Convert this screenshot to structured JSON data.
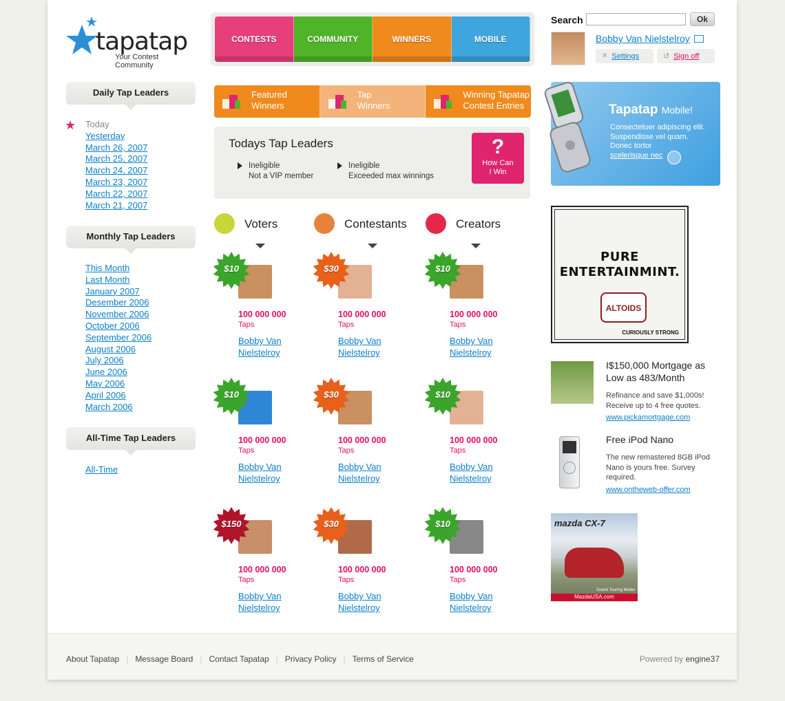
{
  "brand": {
    "name": "tapatap",
    "tagline": "Your Contest Community"
  },
  "nav": [
    {
      "label": "CONTESTS",
      "color": "#e63f7a"
    },
    {
      "label": "COMMUNITY",
      "color": "#4fb428"
    },
    {
      "label": "WINNERS",
      "color": "#f08a1c"
    },
    {
      "label": "MOBILE",
      "color": "#3ea5dd"
    }
  ],
  "search": {
    "label": "Search",
    "button": "Ok"
  },
  "user": {
    "name": "Bobby Van Nielstelroy",
    "settings": "Settings",
    "signoff": "Sign off"
  },
  "sidebar": {
    "daily": {
      "title": "Daily Tap Leaders",
      "today": "Today",
      "links": [
        "Yesterday",
        "March 26, 2007",
        "March 25, 2007",
        "March 24, 2007",
        "March 23, 2007",
        "March 22, 2007",
        "March 21, 2007"
      ]
    },
    "monthly": {
      "title": "Monthly Tap Leaders",
      "links": [
        "This Month",
        "Last Month",
        "January 2007",
        "Desember 2006",
        "November 2006",
        "October 2006",
        "September 2006",
        "August 2006",
        "July 2006",
        "June 2006",
        "May 2006",
        "April 2006",
        "March 2006"
      ]
    },
    "alltime": {
      "title": "All-Time Tap Leaders",
      "links": [
        "All-Time"
      ]
    }
  },
  "feature_tabs": [
    {
      "line1": "Featured",
      "line2": "Winners",
      "color": "#f08a1c"
    },
    {
      "line1": "Tap",
      "line2": "Winners",
      "color": "#f4b37a"
    },
    {
      "line1": "Winning Tapatap",
      "line2": "Contest Entries",
      "color": "#f08a1c"
    }
  ],
  "today": {
    "title": "Todays Tap Leaders",
    "items": [
      {
        "line1": "Ineligible",
        "line2": "Not a VIP member"
      },
      {
        "line1": "Ineligible",
        "line2": "Exceeded max winnings"
      }
    ],
    "how": {
      "q": "?",
      "line1": "How Can",
      "line2": "I Win"
    }
  },
  "columns": [
    {
      "title": "Voters",
      "icon": "voters-icon",
      "color": "#c7d63a"
    },
    {
      "title": "Contestants",
      "icon": "contestants-icon",
      "color": "#e7833a"
    },
    {
      "title": "Creators",
      "icon": "creators-icon",
      "color": "#e5284a"
    }
  ],
  "grid": [
    [
      {
        "prize": "$10",
        "burst": "#3aa52a",
        "count": "100 000 000",
        "unit": "Taps",
        "name": "Bobby Van Nielstelroy",
        "avatar": "#c99060"
      },
      {
        "prize": "$30",
        "burst": "#e8601a",
        "count": "100 000 000",
        "unit": "Taps",
        "name": "Bobby Van Nielstelroy",
        "avatar": "#e3b294"
      },
      {
        "prize": "$10",
        "burst": "#3aa52a",
        "count": "100 000 000",
        "unit": "Taps",
        "name": "Bobby Van Nielstelroy",
        "avatar": "#c99060"
      }
    ],
    [
      {
        "prize": "$10",
        "burst": "#3aa52a",
        "count": "100 000 000",
        "unit": "Taps",
        "name": "Bobby Van Nielstelroy",
        "avatar": "#2f86d6"
      },
      {
        "prize": "$30",
        "burst": "#e8601a",
        "count": "100 000 000",
        "unit": "Taps",
        "name": "Bobby Van Nielstelroy",
        "avatar": "#c99060"
      },
      {
        "prize": "$10",
        "burst": "#3aa52a",
        "count": "100 000 000",
        "unit": "Taps",
        "name": "Bobby Van Nielstelroy",
        "avatar": "#e3b294"
      }
    ],
    [
      {
        "prize": "$150",
        "burst": "#b0142a",
        "count": "100 000 000",
        "unit": "Taps",
        "name": "Bobby Van Nielstelroy",
        "avatar": "#c98e6a"
      },
      {
        "prize": "$30",
        "burst": "#e8601a",
        "count": "100 000 000",
        "unit": "Taps",
        "name": "Bobby Van Nielstelroy",
        "avatar": "#b06a4a"
      },
      {
        "prize": "$10",
        "burst": "#3aa52a",
        "count": "100 000 000",
        "unit": "Taps",
        "name": "Bobby Van Nielstelroy",
        "avatar": "#888888"
      }
    ]
  ],
  "mobile_promo": {
    "title": "Tapatap",
    "title_suffix": "Mobile!",
    "line1": "Consectetuer adipiscing elit.",
    "line2": "Suspendisse vel quam.",
    "line3": "Donec tortor",
    "link": "scelerisque nec"
  },
  "ads": {
    "altoids": {
      "headline1": "PURE",
      "headline2": "ENTERTAINMINT.",
      "brand": "ALTOIDS",
      "slogan": "CURIOUSLY STRONG"
    },
    "mortgage": {
      "title": "I$150,000 Mortgage as Low as 483/Month",
      "body": "Refinance and save $1,000s! Receive up to 4 free quotes.",
      "link": "www.pickamortgage.com"
    },
    "ipod": {
      "title": "Free iPod Nano",
      "body": "The new remastered 8GB iPod Nano is yours free. Survey required.",
      "link": "www.ontheweb-offer.com"
    },
    "mazda": {
      "brand": "mazda CX-7",
      "caption": "Grand Touring Model",
      "url": "MazdaUSA.com"
    }
  },
  "footer": {
    "links": [
      "About Tapatap",
      "Message Board",
      "Contact Tapatap",
      "Privacy Policy",
      "Terms of Service"
    ],
    "powered_prefix": "Powered by",
    "powered_name": "engine37"
  }
}
